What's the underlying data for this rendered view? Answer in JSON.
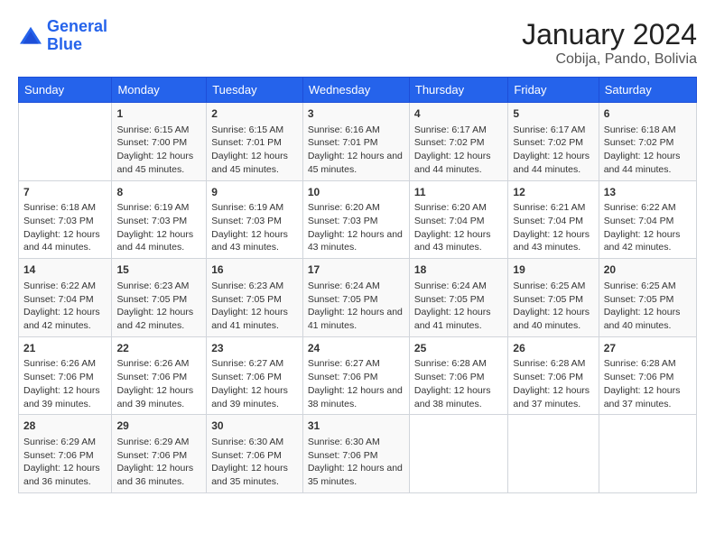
{
  "logo": {
    "line1": "General",
    "line2": "Blue"
  },
  "title": "January 2024",
  "subtitle": "Cobija, Pando, Bolivia",
  "days_of_week": [
    "Sunday",
    "Monday",
    "Tuesday",
    "Wednesday",
    "Thursday",
    "Friday",
    "Saturday"
  ],
  "weeks": [
    [
      {
        "num": "",
        "sunrise": "",
        "sunset": "",
        "daylight": ""
      },
      {
        "num": "1",
        "sunrise": "Sunrise: 6:15 AM",
        "sunset": "Sunset: 7:00 PM",
        "daylight": "Daylight: 12 hours and 45 minutes."
      },
      {
        "num": "2",
        "sunrise": "Sunrise: 6:15 AM",
        "sunset": "Sunset: 7:01 PM",
        "daylight": "Daylight: 12 hours and 45 minutes."
      },
      {
        "num": "3",
        "sunrise": "Sunrise: 6:16 AM",
        "sunset": "Sunset: 7:01 PM",
        "daylight": "Daylight: 12 hours and 45 minutes."
      },
      {
        "num": "4",
        "sunrise": "Sunrise: 6:17 AM",
        "sunset": "Sunset: 7:02 PM",
        "daylight": "Daylight: 12 hours and 44 minutes."
      },
      {
        "num": "5",
        "sunrise": "Sunrise: 6:17 AM",
        "sunset": "Sunset: 7:02 PM",
        "daylight": "Daylight: 12 hours and 44 minutes."
      },
      {
        "num": "6",
        "sunrise": "Sunrise: 6:18 AM",
        "sunset": "Sunset: 7:02 PM",
        "daylight": "Daylight: 12 hours and 44 minutes."
      }
    ],
    [
      {
        "num": "7",
        "sunrise": "Sunrise: 6:18 AM",
        "sunset": "Sunset: 7:03 PM",
        "daylight": "Daylight: 12 hours and 44 minutes."
      },
      {
        "num": "8",
        "sunrise": "Sunrise: 6:19 AM",
        "sunset": "Sunset: 7:03 PM",
        "daylight": "Daylight: 12 hours and 44 minutes."
      },
      {
        "num": "9",
        "sunrise": "Sunrise: 6:19 AM",
        "sunset": "Sunset: 7:03 PM",
        "daylight": "Daylight: 12 hours and 43 minutes."
      },
      {
        "num": "10",
        "sunrise": "Sunrise: 6:20 AM",
        "sunset": "Sunset: 7:03 PM",
        "daylight": "Daylight: 12 hours and 43 minutes."
      },
      {
        "num": "11",
        "sunrise": "Sunrise: 6:20 AM",
        "sunset": "Sunset: 7:04 PM",
        "daylight": "Daylight: 12 hours and 43 minutes."
      },
      {
        "num": "12",
        "sunrise": "Sunrise: 6:21 AM",
        "sunset": "Sunset: 7:04 PM",
        "daylight": "Daylight: 12 hours and 43 minutes."
      },
      {
        "num": "13",
        "sunrise": "Sunrise: 6:22 AM",
        "sunset": "Sunset: 7:04 PM",
        "daylight": "Daylight: 12 hours and 42 minutes."
      }
    ],
    [
      {
        "num": "14",
        "sunrise": "Sunrise: 6:22 AM",
        "sunset": "Sunset: 7:04 PM",
        "daylight": "Daylight: 12 hours and 42 minutes."
      },
      {
        "num": "15",
        "sunrise": "Sunrise: 6:23 AM",
        "sunset": "Sunset: 7:05 PM",
        "daylight": "Daylight: 12 hours and 42 minutes."
      },
      {
        "num": "16",
        "sunrise": "Sunrise: 6:23 AM",
        "sunset": "Sunset: 7:05 PM",
        "daylight": "Daylight: 12 hours and 41 minutes."
      },
      {
        "num": "17",
        "sunrise": "Sunrise: 6:24 AM",
        "sunset": "Sunset: 7:05 PM",
        "daylight": "Daylight: 12 hours and 41 minutes."
      },
      {
        "num": "18",
        "sunrise": "Sunrise: 6:24 AM",
        "sunset": "Sunset: 7:05 PM",
        "daylight": "Daylight: 12 hours and 41 minutes."
      },
      {
        "num": "19",
        "sunrise": "Sunrise: 6:25 AM",
        "sunset": "Sunset: 7:05 PM",
        "daylight": "Daylight: 12 hours and 40 minutes."
      },
      {
        "num": "20",
        "sunrise": "Sunrise: 6:25 AM",
        "sunset": "Sunset: 7:05 PM",
        "daylight": "Daylight: 12 hours and 40 minutes."
      }
    ],
    [
      {
        "num": "21",
        "sunrise": "Sunrise: 6:26 AM",
        "sunset": "Sunset: 7:06 PM",
        "daylight": "Daylight: 12 hours and 39 minutes."
      },
      {
        "num": "22",
        "sunrise": "Sunrise: 6:26 AM",
        "sunset": "Sunset: 7:06 PM",
        "daylight": "Daylight: 12 hours and 39 minutes."
      },
      {
        "num": "23",
        "sunrise": "Sunrise: 6:27 AM",
        "sunset": "Sunset: 7:06 PM",
        "daylight": "Daylight: 12 hours and 39 minutes."
      },
      {
        "num": "24",
        "sunrise": "Sunrise: 6:27 AM",
        "sunset": "Sunset: 7:06 PM",
        "daylight": "Daylight: 12 hours and 38 minutes."
      },
      {
        "num": "25",
        "sunrise": "Sunrise: 6:28 AM",
        "sunset": "Sunset: 7:06 PM",
        "daylight": "Daylight: 12 hours and 38 minutes."
      },
      {
        "num": "26",
        "sunrise": "Sunrise: 6:28 AM",
        "sunset": "Sunset: 7:06 PM",
        "daylight": "Daylight: 12 hours and 37 minutes."
      },
      {
        "num": "27",
        "sunrise": "Sunrise: 6:28 AM",
        "sunset": "Sunset: 7:06 PM",
        "daylight": "Daylight: 12 hours and 37 minutes."
      }
    ],
    [
      {
        "num": "28",
        "sunrise": "Sunrise: 6:29 AM",
        "sunset": "Sunset: 7:06 PM",
        "daylight": "Daylight: 12 hours and 36 minutes."
      },
      {
        "num": "29",
        "sunrise": "Sunrise: 6:29 AM",
        "sunset": "Sunset: 7:06 PM",
        "daylight": "Daylight: 12 hours and 36 minutes."
      },
      {
        "num": "30",
        "sunrise": "Sunrise: 6:30 AM",
        "sunset": "Sunset: 7:06 PM",
        "daylight": "Daylight: 12 hours and 35 minutes."
      },
      {
        "num": "31",
        "sunrise": "Sunrise: 6:30 AM",
        "sunset": "Sunset: 7:06 PM",
        "daylight": "Daylight: 12 hours and 35 minutes."
      },
      {
        "num": "",
        "sunrise": "",
        "sunset": "",
        "daylight": ""
      },
      {
        "num": "",
        "sunrise": "",
        "sunset": "",
        "daylight": ""
      },
      {
        "num": "",
        "sunrise": "",
        "sunset": "",
        "daylight": ""
      }
    ]
  ]
}
